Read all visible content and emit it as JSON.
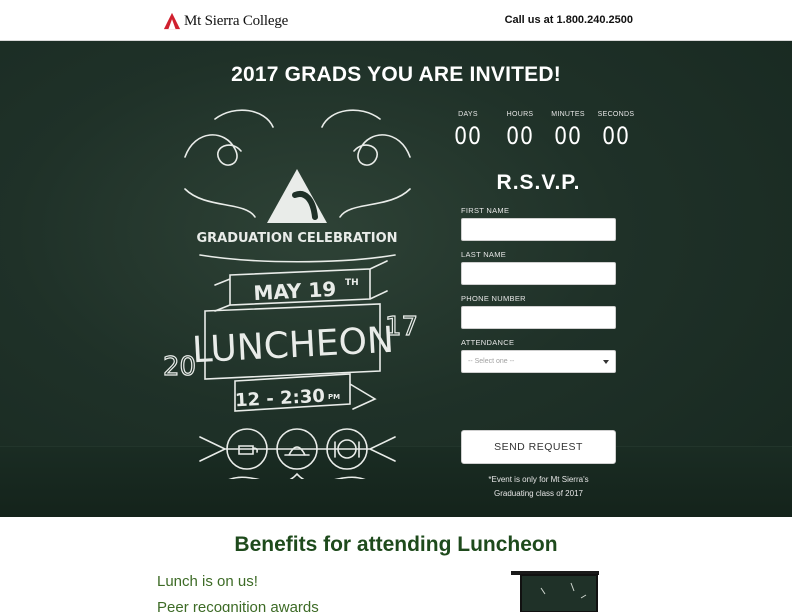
{
  "header": {
    "logo_text": "Mt Sierra College",
    "phone_text": "Call us at 1.800.240.2500"
  },
  "hero": {
    "title": "2017 GRADS YOU ARE INVITED!",
    "art": {
      "heading": "GRADUATION CELEBRATION",
      "date": "MAY 19",
      "date_suffix": "TH",
      "event": "LUNCHEON",
      "year_left": "20",
      "year_right": "17",
      "time": "12 - 2:30",
      "time_suffix": "PM"
    }
  },
  "countdown": [
    {
      "label": "DAYS",
      "value": "00"
    },
    {
      "label": "HOURS",
      "value": "00"
    },
    {
      "label": "MINUTES",
      "value": "00"
    },
    {
      "label": "SECONDS",
      "value": "00"
    }
  ],
  "rsvp": {
    "title": "R.S.V.P.",
    "fields": {
      "first_name_label": "FIRST NAME",
      "last_name_label": "LAST NAME",
      "phone_label": "PHONE NUMBER",
      "attendance_label": "ATTENDANCE",
      "attendance_selected": "-- Select one --"
    },
    "submit_label": "SEND REQUEST",
    "note_line1": "*Event is only for Mt Sierra's",
    "note_line2": "Graduating class of 2017"
  },
  "benefits": {
    "title": "Benefits for attending Luncheon",
    "items": [
      "Lunch is on us!",
      "Peer recognition awards"
    ]
  },
  "colors": {
    "hero_bg": "#1f3128",
    "brand_red": "#d0202e",
    "benefit_green": "#3d6b26",
    "title_green": "#1e4a1c"
  },
  "icons": [
    "logo-triangle-icon",
    "coffee-cup-icon",
    "serving-cloche-icon",
    "plate-cutlery-icon",
    "chalkboard-icon",
    "dropdown-caret-icon"
  ]
}
